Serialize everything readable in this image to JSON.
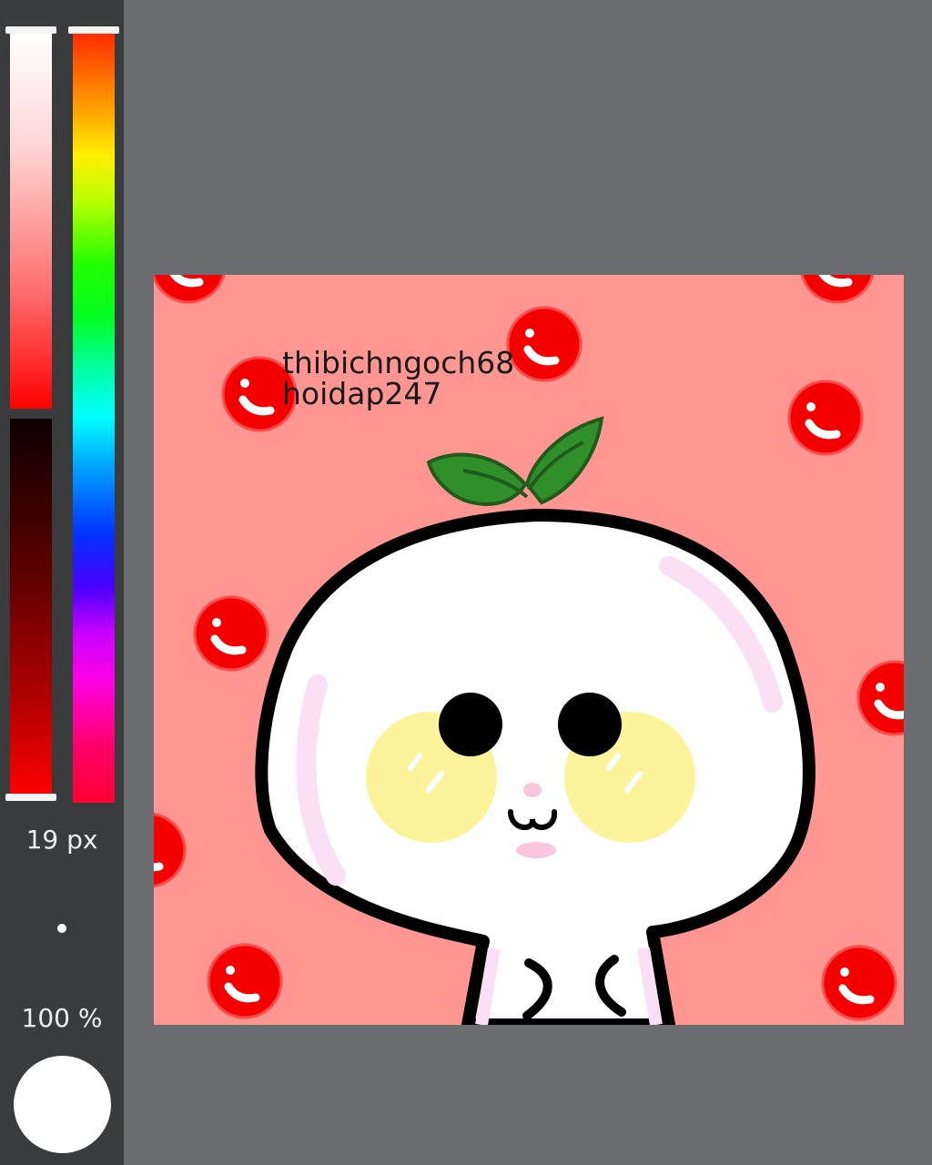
{
  "toolbar": {
    "brush_size": "19 px",
    "opacity": "100 %",
    "current_color": "#ffffff",
    "base_hue_color": "#ff0000"
  },
  "canvas": {
    "background_color": "#ff9692",
    "watermark_lines": [
      "thibichngoch68",
      "hoidap247"
    ],
    "icons": [
      "red-bubble-icon",
      "leaf-sprout-icon"
    ]
  }
}
